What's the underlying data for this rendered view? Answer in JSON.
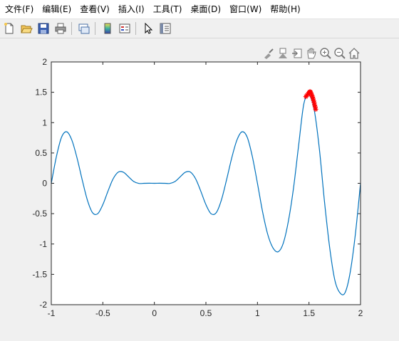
{
  "menu": [
    {
      "label": "文件(F)",
      "name": "menu-file"
    },
    {
      "label": "编辑(E)",
      "name": "menu-edit"
    },
    {
      "label": "查看(V)",
      "name": "menu-view"
    },
    {
      "label": "插入(I)",
      "name": "menu-insert"
    },
    {
      "label": "工具(T)",
      "name": "menu-tools"
    },
    {
      "label": "桌面(D)",
      "name": "menu-desktop"
    },
    {
      "label": "窗口(W)",
      "name": "menu-window"
    },
    {
      "label": "帮助(H)",
      "name": "menu-help"
    }
  ],
  "toolbar_icons": [
    "new-figure-icon",
    "open-file-icon",
    "save-icon",
    "print-icon",
    "link-plot-icon",
    "insert-colorbar-icon",
    "insert-legend-icon",
    "edit-plot-pointer-icon",
    "property-inspector-icon"
  ],
  "axes_toolbar_icons": [
    "brush-data-icon",
    "data-tips-icon",
    "export-icon",
    "pan-hand-icon",
    "zoom-in-icon",
    "zoom-out-icon",
    "restore-view-home-icon"
  ],
  "chart_data": {
    "type": "line",
    "title": "",
    "xlabel": "",
    "ylabel": "",
    "xlim": [
      -1,
      2
    ],
    "ylim": [
      -2,
      2
    ],
    "xticks": [
      "-1",
      "-0.5",
      "0",
      "0.5",
      "1",
      "1.5",
      "2"
    ],
    "yticks": [
      "2",
      "1.5",
      "1",
      "0.5",
      "0",
      "-0.5",
      "-1",
      "-1.5",
      "-2"
    ],
    "series": [
      {
        "style": "line",
        "color": "#0072BD",
        "x": [
          -1.0,
          -0.95,
          -0.9,
          -0.85,
          -0.8,
          -0.75,
          -0.7,
          -0.65,
          -0.6,
          -0.55,
          -0.5,
          -0.45,
          -0.4,
          -0.35,
          -0.3,
          -0.25,
          -0.2,
          -0.15,
          -0.1,
          -0.05,
          0.0,
          0.05,
          0.1,
          0.15,
          0.2,
          0.25,
          0.3,
          0.35,
          0.4,
          0.45,
          0.5,
          0.55,
          0.6,
          0.65,
          0.7,
          0.75,
          0.8,
          0.85,
          0.9,
          0.95,
          1.0,
          1.05,
          1.1,
          1.15,
          1.2,
          1.25,
          1.3,
          1.35,
          1.4,
          1.45,
          1.5,
          1.55,
          1.6,
          1.65,
          1.7,
          1.75,
          1.8,
          1.85,
          1.9,
          1.95,
          2.0
        ],
        "y": [
          0.0,
          0.444,
          0.762,
          0.849,
          0.709,
          0.415,
          0.056,
          -0.276,
          -0.484,
          -0.501,
          -0.351,
          -0.128,
          0.075,
          0.185,
          0.182,
          0.106,
          0.029,
          -0.002,
          0.0,
          0.001,
          0.0,
          0.001,
          0.0,
          -0.002,
          0.029,
          0.106,
          0.182,
          0.185,
          0.075,
          -0.128,
          -0.351,
          -0.501,
          -0.484,
          -0.276,
          0.056,
          0.415,
          0.709,
          0.849,
          0.762,
          0.444,
          0.0,
          -0.471,
          -0.843,
          -1.062,
          -1.128,
          -0.989,
          -0.624,
          -0.077,
          0.631,
          1.309,
          1.45,
          1.217,
          0.578,
          -0.296,
          -1.049,
          -1.589,
          -1.804,
          -1.802,
          -1.465,
          -0.838,
          0.0
        ]
      },
      {
        "style": "markers",
        "marker": "*",
        "color": "#FF0000",
        "x": [
          1.47,
          1.48,
          1.49,
          1.5,
          1.505,
          1.51,
          1.515,
          1.52,
          1.525,
          1.53,
          1.535,
          1.54,
          1.545,
          1.55,
          1.555,
          1.56,
          1.565
        ],
        "y": [
          1.43,
          1.45,
          1.47,
          1.49,
          1.5,
          1.51,
          1.5,
          1.48,
          1.46,
          1.44,
          1.42,
          1.39,
          1.36,
          1.33,
          1.29,
          1.26,
          1.22
        ]
      }
    ]
  }
}
